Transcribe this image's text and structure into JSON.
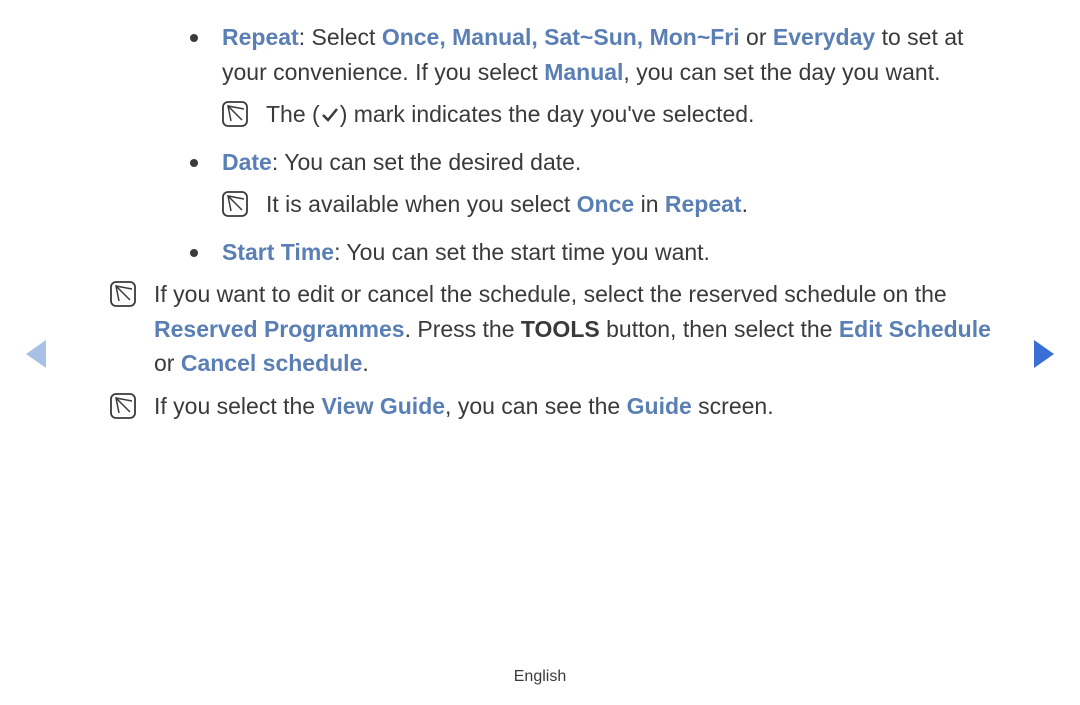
{
  "items": {
    "repeat": {
      "label": "Repeat",
      "sep": ": Select ",
      "opts": "Once, Manual, Sat~Sun, Mon~Fri",
      "or": " or ",
      "last": "Everyday",
      "tail1": " to set at your convenience. If you select ",
      "manual": "Manual",
      "tail2": ", you can set the day you want."
    },
    "repeat_note": {
      "pre": "The (",
      "post": ") mark indicates the day you've selected."
    },
    "date": {
      "label": "Date",
      "tail": ": You can set the desired date."
    },
    "date_note": {
      "pre": "It is available when you select ",
      "once": "Once",
      "in": " in ",
      "repeat": "Repeat",
      "dot": "."
    },
    "start": {
      "label": "Start Time",
      "tail": ": You can set the start time you want."
    }
  },
  "outer1": {
    "pre": "If you want to edit or cancel the schedule, select the reserved schedule on the ",
    "reserved": "Reserved Programmes",
    "mid1": ". Press the ",
    "tools": "TOOLS",
    "mid2": " button, then select the ",
    "edit": "Edit Schedule",
    "or": " or ",
    "cancel": "Cancel schedule",
    "dot": "."
  },
  "outer2": {
    "pre": "If you select the ",
    "view": "View Guide",
    "mid": ", you can see the ",
    "guide": "Guide",
    "post": " screen."
  },
  "footer": "English"
}
